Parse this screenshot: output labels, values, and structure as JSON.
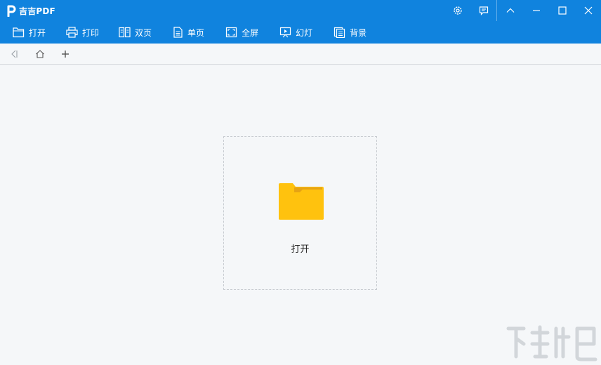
{
  "app": {
    "title": "吉吉PDF"
  },
  "window_controls": [
    "gear-icon",
    "feedback-icon",
    "collapse-icon",
    "minimize-icon",
    "maximize-icon",
    "close-icon"
  ],
  "toolbar": {
    "items": [
      {
        "label": "打开",
        "icon": "open-file-icon"
      },
      {
        "label": "打印",
        "icon": "printer-icon"
      },
      {
        "label": "双页",
        "icon": "two-page-icon"
      },
      {
        "label": "单页",
        "icon": "single-page-icon"
      },
      {
        "label": "全屏",
        "icon": "fullscreen-icon"
      },
      {
        "label": "幻灯",
        "icon": "slideshow-icon"
      },
      {
        "label": "背景",
        "icon": "background-icon"
      }
    ]
  },
  "tabbar": {
    "icons": [
      "back-icon",
      "home-icon",
      "new-tab-icon"
    ]
  },
  "main": {
    "open_label": "打开",
    "icon": "folder-icon"
  },
  "colors": {
    "titlebar": "#1083de",
    "background": "#f5f7f9",
    "folder": "#ffc20e",
    "folder_tab": "#e6a314"
  }
}
